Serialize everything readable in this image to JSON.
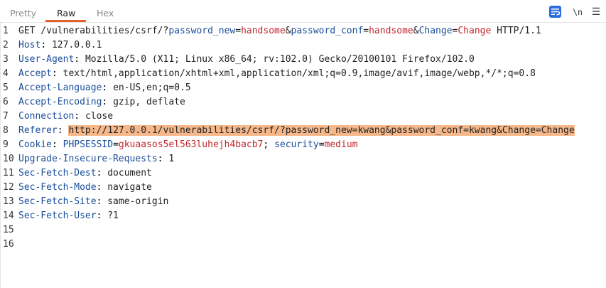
{
  "tabs": [
    {
      "label": "Pretty",
      "active": false
    },
    {
      "label": "Raw",
      "active": true
    },
    {
      "label": "Hex",
      "active": false
    }
  ],
  "toolbar": {
    "wrap_icon": "text-wrap-icon",
    "newline_label": "\\n",
    "menu_icon": "hamburger-menu-icon"
  },
  "colors": {
    "accent": "#e8612c",
    "header_name": "#1a4d9a",
    "param_value": "#c1272d",
    "highlight": "#f6b88a",
    "wrap_button": "#2d6cdf"
  },
  "request": {
    "line1": {
      "method": "GET /vulnerabilities/csrf/?",
      "p1n": "password_new",
      "p1v": "handsome",
      "p2n": "password_conf",
      "p2v": "handsome",
      "p3n": "Change",
      "p3v": "Change",
      "proto": " HTTP/1.1"
    },
    "host": {
      "name": "Host",
      "value": "127.0.0.1"
    },
    "user_agent": {
      "name": "User-Agent",
      "value": "Mozilla/5.0 (X11; Linux x86_64; rv:102.0) Gecko/20100101 Firefox/102.0"
    },
    "accept": {
      "name": "Accept",
      "value": "text/html,application/xhtml+xml,application/xml;q=0.9,image/avif,image/webp,*/*;q=0.8"
    },
    "accept_language": {
      "name": "Accept-Language",
      "value": "en-US,en;q=0.5"
    },
    "accept_encoding": {
      "name": "Accept-Encoding",
      "value": "gzip, deflate"
    },
    "connection": {
      "name": "Connection",
      "value": "close"
    },
    "referer": {
      "name": "Referer",
      "value": "http://127.0.0.1/vulnerabilities/csrf/?password_new=kwang&password_conf=kwang&Change=Change"
    },
    "cookie": {
      "name": "Cookie",
      "c1n": "PHPSESSID",
      "c1v": "gkuaasos5el563luhejh4bacb7",
      "c2n": "security",
      "c2v": "medium"
    },
    "upgrade": {
      "name": "Upgrade-Insecure-Requests",
      "value": "1"
    },
    "sec_dest": {
      "name": "Sec-Fetch-Dest",
      "value": "document"
    },
    "sec_mode": {
      "name": "Sec-Fetch-Mode",
      "value": "navigate"
    },
    "sec_site": {
      "name": "Sec-Fetch-Site",
      "value": "same-origin"
    },
    "sec_user": {
      "name": "Sec-Fetch-User",
      "value": "?1"
    }
  },
  "line_numbers": [
    "1",
    "2",
    "3",
    "4",
    "5",
    "6",
    "7",
    "8",
    "9",
    "10",
    "11",
    "12",
    "13",
    "14",
    "15",
    "16"
  ]
}
